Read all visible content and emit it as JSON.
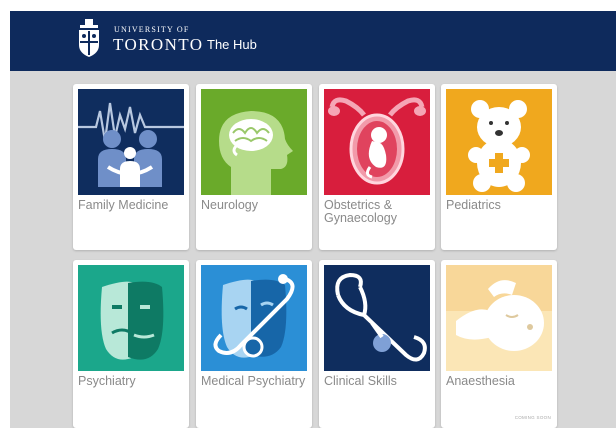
{
  "header": {
    "university_small": "UNIVERSITY OF",
    "university_big": "TORONTO",
    "hub_title": "The Hub"
  },
  "colors": {
    "header_bg": "#0e2a5c",
    "page_bg": "#d7d7d7"
  },
  "cards": [
    {
      "label": "Family Medicine",
      "icon": "family-icon",
      "color": "#0f2d5e"
    },
    {
      "label": "Neurology",
      "icon": "brain-head-icon",
      "color": "#6aaa2a"
    },
    {
      "label": "Obstetrics & Gynaecology",
      "icon": "fetus-uterus-icon",
      "color": "#d81e3d"
    },
    {
      "label": "Pediatrics",
      "icon": "teddy-bear-icon",
      "color": "#f0a81e"
    },
    {
      "label": "Psychiatry",
      "icon": "masks-icon",
      "color": "#1ba78b"
    },
    {
      "label": "Medical Psychiatry",
      "icon": "masks-stethoscope-icon",
      "color": "#2b8fd6"
    },
    {
      "label": "Clinical Skills",
      "icon": "stethoscope-icon",
      "color": "#0f2d5e"
    },
    {
      "label": "Anaesthesia",
      "icon": "sleeping-face-icon",
      "color": "#f0a81e",
      "badge": "COMING SOON"
    }
  ]
}
